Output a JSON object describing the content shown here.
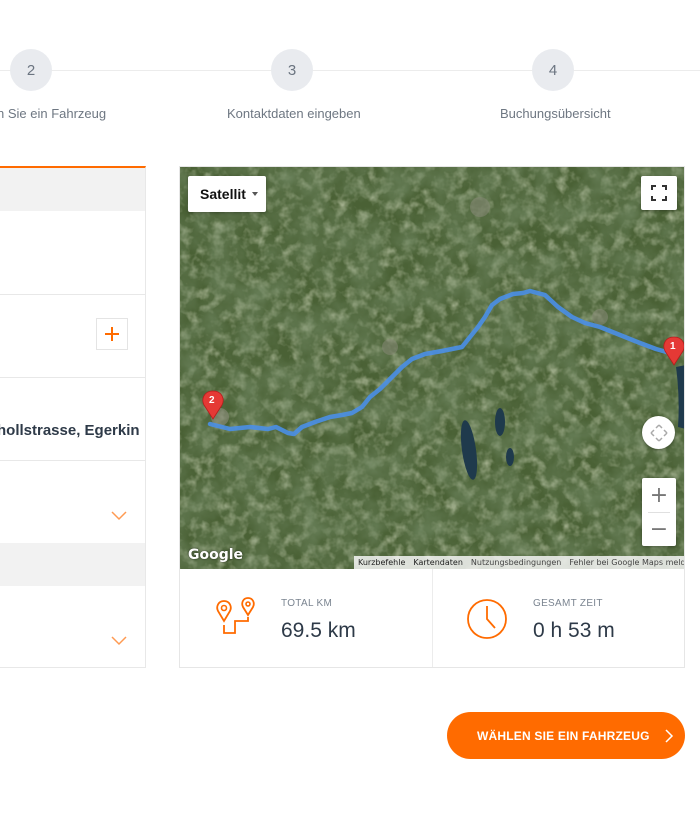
{
  "stepper": {
    "steps": [
      {
        "number": "2",
        "label": "n Sie ein Fahrzeug"
      },
      {
        "number": "3",
        "label": "Kontaktdaten eingeben"
      },
      {
        "number": "4",
        "label": "Buchungsübersicht"
      }
    ]
  },
  "form": {
    "address_value": "hollstrasse, Egerkin"
  },
  "map": {
    "map_type_label": "Satellit",
    "google_logo": "Google",
    "zoom_in": "+",
    "zoom_out": "−",
    "markers": [
      {
        "label": "1"
      },
      {
        "label": "2"
      }
    ],
    "attribution": [
      "Kurzbefehle",
      "Kartendaten",
      "Nutzungsbedingungen",
      "Fehler bei Google Maps melden"
    ],
    "route_color": "#4a8fe7",
    "marker_color": "#e53935"
  },
  "stats": {
    "total_km": {
      "label": "TOTAL KM",
      "value": "69.5 km",
      "icon": "route-pin-icon"
    },
    "total_time": {
      "label": "GESAMT ZEIT",
      "value": "0 h 53 m",
      "icon": "clock-icon"
    }
  },
  "cta": {
    "label": "WÄHLEN SIE EIN FAHRZEUG",
    "icon": "chevron-right-icon"
  },
  "colors": {
    "accent": "#ff6b00",
    "text": "#2e3a48",
    "muted": "#6e7782"
  }
}
